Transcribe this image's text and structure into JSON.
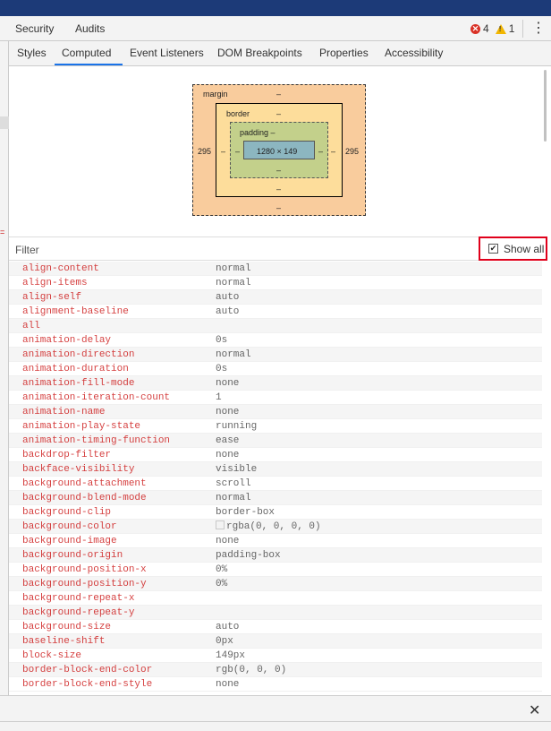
{
  "main_tabs": [
    "Security",
    "Audits"
  ],
  "status": {
    "errors": "4",
    "warnings": "1"
  },
  "sub_tabs": [
    "Styles",
    "Computed",
    "Event Listeners",
    "DOM Breakpoints",
    "Properties",
    "Accessibility"
  ],
  "active_sub_tab": "Computed",
  "box_model": {
    "margin_label": "margin",
    "margin_top": "–",
    "margin_bottom": "–",
    "margin_left": "295",
    "margin_right": "295",
    "border_label": "border",
    "border_top": "–",
    "border_bottom": "–",
    "border_left": "–",
    "border_right": "–",
    "padding_label": "padding –",
    "padding_bottom": "–",
    "padding_left": "–",
    "padding_right": "–",
    "content_size": "1280 × 149"
  },
  "filter": {
    "placeholder": "Filter"
  },
  "show_all": {
    "label": "Show all",
    "checked": true
  },
  "properties": [
    {
      "name": "align-content",
      "value": "normal"
    },
    {
      "name": "align-items",
      "value": "normal"
    },
    {
      "name": "align-self",
      "value": "auto"
    },
    {
      "name": "alignment-baseline",
      "value": "auto"
    },
    {
      "name": "all",
      "value": ""
    },
    {
      "name": "animation-delay",
      "value": "0s"
    },
    {
      "name": "animation-direction",
      "value": "normal"
    },
    {
      "name": "animation-duration",
      "value": "0s"
    },
    {
      "name": "animation-fill-mode",
      "value": "none"
    },
    {
      "name": "animation-iteration-count",
      "value": "1"
    },
    {
      "name": "animation-name",
      "value": "none"
    },
    {
      "name": "animation-play-state",
      "value": "running"
    },
    {
      "name": "animation-timing-function",
      "value": "ease"
    },
    {
      "name": "backdrop-filter",
      "value": "none"
    },
    {
      "name": "backface-visibility",
      "value": "visible"
    },
    {
      "name": "background-attachment",
      "value": "scroll"
    },
    {
      "name": "background-blend-mode",
      "value": "normal"
    },
    {
      "name": "background-clip",
      "value": "border-box"
    },
    {
      "name": "background-color",
      "value": "rgba(0, 0, 0, 0)",
      "swatch": true
    },
    {
      "name": "background-image",
      "value": "none"
    },
    {
      "name": "background-origin",
      "value": "padding-box"
    },
    {
      "name": "background-position-x",
      "value": "0%"
    },
    {
      "name": "background-position-y",
      "value": "0%"
    },
    {
      "name": "background-repeat-x",
      "value": ""
    },
    {
      "name": "background-repeat-y",
      "value": ""
    },
    {
      "name": "background-size",
      "value": "auto"
    },
    {
      "name": "baseline-shift",
      "value": "0px"
    },
    {
      "name": "block-size",
      "value": "149px"
    },
    {
      "name": "border-block-end-color",
      "value": "rgb(0, 0, 0)"
    },
    {
      "name": "border-block-end-style",
      "value": "none"
    }
  ],
  "close_label": "✕",
  "colors": {
    "title_bar": "#1c3a78",
    "tab_active_underline": "#1a73e8",
    "property_name": "#c80000",
    "margin": "#f9cc9d",
    "border": "#fddd9b",
    "padding": "#c3d08b",
    "content": "#8cb6c0",
    "highlight": "#e0001b"
  }
}
